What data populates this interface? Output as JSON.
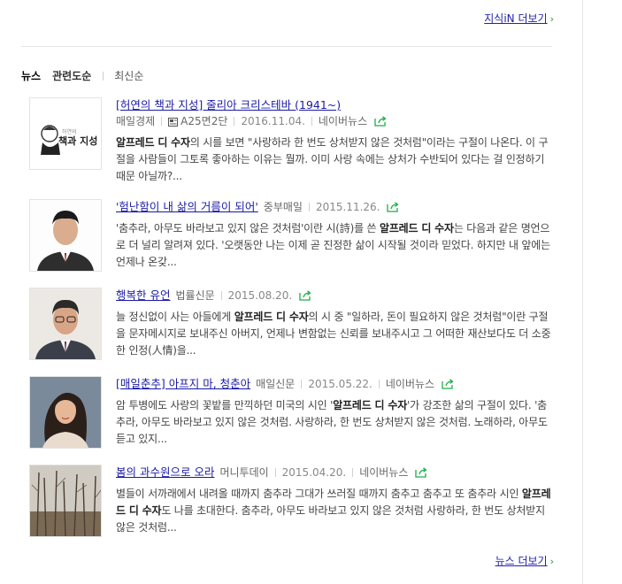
{
  "links": {
    "kin_more": "지식iN 더보기",
    "news_more": "뉴스 더보기"
  },
  "tabs": [
    {
      "label": "뉴스"
    },
    {
      "label": "관련도순"
    },
    {
      "label": "최신순"
    }
  ],
  "news": [
    {
      "title": "[허연의 책과 지성] 줄리아 크리스테바 (1941~)",
      "source": "매일경제",
      "page": "A25면2단",
      "date": "2016.11.04.",
      "naver": "네이버뉴스",
      "thumb_text": "책과 지성",
      "desc": [
        "알프레드 디 수자",
        "의 시를 보면 \"사랑하라 한 번도 상처받지 않은 것처럼\"이라는 구절이 나온다. 이 구절을 사람들이 그토록 좋아하는 이유는 뭘까. 이미 사랑 속에는 상처가 수반되어 있다는 걸 인정하기 때문 아닐까?..."
      ]
    },
    {
      "title": "'험난함이 내 삶의 거름이 되어'",
      "source": "중부매일",
      "date": "2015.11.26.",
      "desc": [
        "'춤추라, 아무도 바라보고 있지 않은 것처럼'이란 시(詩)를 쓴 ",
        "알프레드 디 수자",
        "는 다음과 같은 명언으로 더 널리 알려져 있다. '오랫동안 나는 이제 곧 진정한 삶이 시작될 것이라 믿었다. 하지만 내 앞에는 언제나 온갖..."
      ]
    },
    {
      "title": "행복한 유언",
      "source": "법률신문",
      "date": "2015.08.20.",
      "desc": [
        "늘 정신없이 사는 아들에게 ",
        "알프레드 디 수자",
        "의 시 중 \"일하라, 돈이 필요하지 않은 것처럼\"이란 구절을 문자메시지로 보내주신 아버지, 언제나 변함없는 신뢰를 보내주시고 그 어떠한 재산보다도 더 소중한 인정(人情)을..."
      ]
    },
    {
      "title": "[매일춘추] 아프지 마, 청춘아",
      "source": "매일신문",
      "date": "2015.05.22.",
      "naver": "네이버뉴스",
      "desc": [
        "암 투병에도 사랑의 꽃밭를 만끽하던 미국의 시인 '",
        "알프레드 디 수자",
        "'가 강조한 삶의 구절이 있다. '춤추라, 아무도 바라보고 있지 않은 것처럼. 사랑하라, 한 번도 상처받지 않은 것처럼. 노래하라, 아무도 듣고 있지..."
      ]
    },
    {
      "title": "봄의 과수원으로 오라",
      "source": "머니투데이",
      "date": "2015.04.20.",
      "naver": "네이버뉴스",
      "desc": [
        "별들이 서까래에서 내려올 때까지 춤추라 그대가 쓰러질 때까지 춤추고 춤추고 또 춤추라 시인 ",
        "알프레드 디 수자",
        "도 나를 초대한다. 춤추라, 아무도 바라보고 있지 않은 것처럼 사랑하라, 한 번도 상처받지 않은 것처럼..."
      ]
    }
  ],
  "colors": {
    "link": "#1a1aa6",
    "accent": "#0b9f31",
    "text": "#444444"
  },
  "icons": {
    "more": "chevron-right-icon",
    "share": "share-icon",
    "paper": "newspaper-icon"
  }
}
